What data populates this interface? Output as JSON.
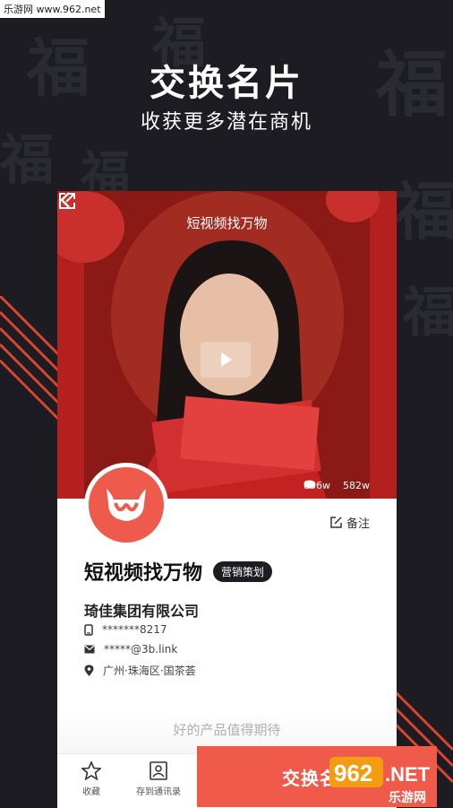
{
  "watermark_top": "乐游网 www.962.net",
  "hero": {
    "title": "交换名片",
    "subtitle": "收获更多潜在商机"
  },
  "card": {
    "header_title": "短视频找万物",
    "views": "856w",
    "likes": "582w",
    "note_label": "备注",
    "name": "短视频找万物",
    "tag": "营销策划",
    "company": "琦佳集团有限公司",
    "phone": "*******8217",
    "email": "*****@3b.link",
    "location": "广州·珠海区·国茶荟",
    "slogan": "好的产品值得期待"
  },
  "bottom": {
    "favorite_label": "收藏",
    "save_contacts_label": "存到通讯录",
    "exchange_label": "交换名"
  },
  "watermark_br": {
    "logo": "962",
    "net": ".NET",
    "site": "乐游网"
  },
  "colors": {
    "accent": "#ef5a4a",
    "background": "#1c1c22",
    "tag_bg": "#1c1c22"
  }
}
